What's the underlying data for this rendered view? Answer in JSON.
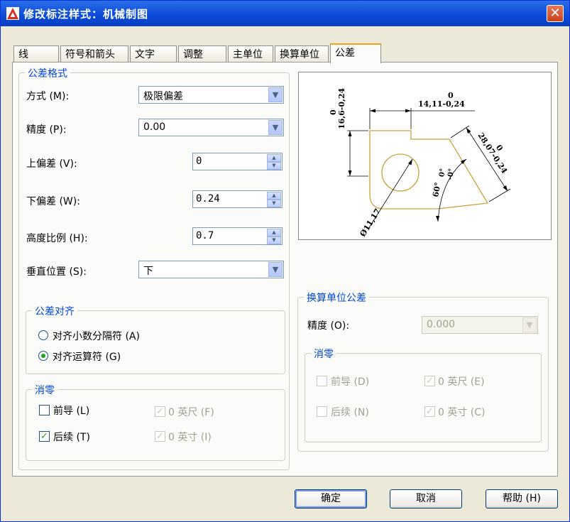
{
  "window": {
    "title": "修改标注样式：机械制图",
    "close_glyph": "✕"
  },
  "tabs": [
    {
      "label": "线",
      "active": false
    },
    {
      "label": "符号和箭头",
      "active": false
    },
    {
      "label": "文字",
      "active": false
    },
    {
      "label": "调整",
      "active": false
    },
    {
      "label": "主单位",
      "active": false
    },
    {
      "label": "换算单位",
      "active": false
    },
    {
      "label": "公差",
      "active": true
    }
  ],
  "tolerance_format": {
    "title": "公差格式",
    "method": {
      "label": "方式 (M):",
      "value": "极限偏差"
    },
    "precision": {
      "label": "精度 (P):",
      "value": "0.00"
    },
    "upper": {
      "label": "上偏差 (V):",
      "value": "0"
    },
    "lower": {
      "label": "下偏差 (W):",
      "value": "0.24"
    },
    "height_scale": {
      "label": "高度比例 (H):",
      "value": "0.7"
    },
    "vertical_position": {
      "label": "垂直位置 (S):",
      "value": "下"
    }
  },
  "tolerance_align": {
    "title": "公差对齐",
    "decimal": {
      "label": "对齐小数分隔符 (A)",
      "checked": false
    },
    "operator": {
      "label": "对齐运算符 (G)",
      "checked": true
    }
  },
  "zero_suppress": {
    "title": "消零",
    "leading": {
      "label": "前导 (L)",
      "checked": false
    },
    "trailing": {
      "label": "后续 (T)",
      "checked": true
    },
    "feet": {
      "label": "0 英尺 (F)",
      "checked": true
    },
    "inches": {
      "label": "0 英寸 (I)",
      "checked": true
    }
  },
  "alt_unit_tolerance": {
    "title": "换算单位公差",
    "precision": {
      "label": "精度 (O):",
      "value": "0.000"
    },
    "zero_suppress": {
      "title": "消零",
      "leading": {
        "label": "前导 (D)",
        "checked": false
      },
      "trailing": {
        "label": "后续 (N)",
        "checked": false
      },
      "feet": {
        "label": "0 英尺 (E)",
        "checked": true
      },
      "inches": {
        "label": "0 英寸 (C)",
        "checked": true
      }
    }
  },
  "preview": {
    "dim_top": "14,11",
    "tol_top_upper": "0",
    "tol_top_lower": "-0,24",
    "dim_left": "16,6",
    "tol_left_upper": "0",
    "tol_left_lower": "-0,24",
    "dim_right": "28,07",
    "tol_right_upper": "0",
    "tol_right_lower": "-0,24",
    "dim_diameter": "Ø11,17",
    "dim_angle": "60°",
    "tol_angle_upper": "0°",
    "tol_angle_lower": "-0°"
  },
  "buttons": {
    "ok": "确定",
    "cancel": "取消",
    "help": "帮助 (H)"
  },
  "colors": {
    "accent": "#0046d5",
    "titlebar": "#0b4ad8",
    "tab_highlight": "#f6a11a",
    "part_outline": "#c9a23a"
  },
  "icons": {
    "app": "autocad-icon",
    "dropdown": "chevron-down-icon"
  }
}
